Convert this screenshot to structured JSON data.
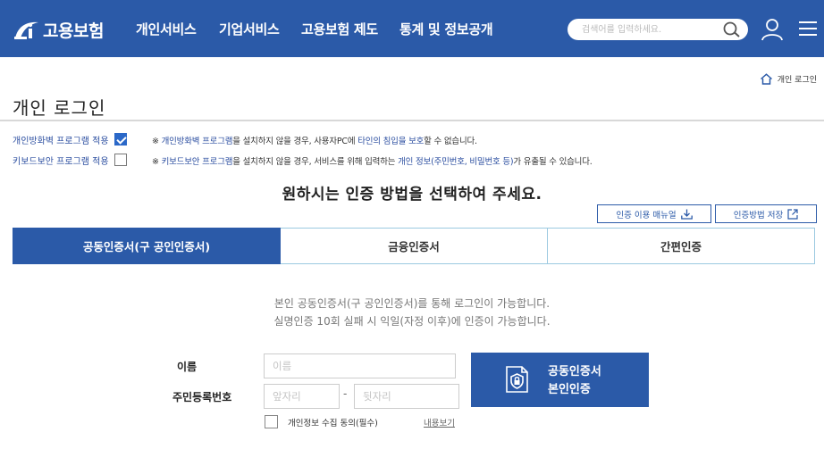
{
  "header": {
    "logo_text": "고용보험",
    "nav": [
      "개인서비스",
      "기업서비스",
      "고용보험 제도",
      "통계 및 정보공개"
    ],
    "search_placeholder": "검색어를 입력하세요.",
    "brand_color": "#2b5aa8"
  },
  "breadcrumb": {
    "home_label": "개인 로그인"
  },
  "page_title": "개인 로그인",
  "options": {
    "firewall": {
      "label": "개인방화벽 프로그램 적용",
      "checked": true,
      "note_mark": "※",
      "note_hl1": "개인방화벽 프로그램",
      "note_mid": "을 설치하지 않을 경우, 사용자PC에",
      "note_hl2": "타인의 침입을 보호",
      "note_end": "할 수 없습니다."
    },
    "keyboard": {
      "label": "키보드보안 프로그램 적용",
      "checked": false,
      "note_mark": "※",
      "note_hl1": "키보드보안 프로그램",
      "note_mid": "을 설치하지 않을 경우, 서비스를 위해 입력하는",
      "note_hl2": "개인 정보(주민번호, 비밀번호 등)",
      "note_end": "가 유출될 수 있습니다."
    }
  },
  "instruction": "원하시는 인증 방법을 선택하여 주세요.",
  "tools": {
    "manual": "인증 이용 매뉴얼",
    "save": "인증방법 저장"
  },
  "tabs": [
    {
      "label": "공동인증서(구 공인인증서)",
      "active": true
    },
    {
      "label": "금융인증서",
      "active": false
    },
    {
      "label": "간편인증",
      "active": false
    }
  ],
  "description": {
    "line1": "본인 공동인증서(구 공인인증서)를 통해 로그인이 가능합니다.",
    "line2": "실명인증 10회 실패 시 익일(자정 이후)에 인증이 가능합니다."
  },
  "form": {
    "name_label": "이름",
    "name_placeholder": "이름",
    "rrn_label": "주민등록번호",
    "rrn_front_placeholder": "앞자리",
    "rrn_separator": "-",
    "rrn_back_placeholder": "뒷자리"
  },
  "cert_button": {
    "line1": "공동인증서",
    "line2": "본인인증"
  },
  "agreement": {
    "label": "개인정보 수집 동의(필수)",
    "link": "내용보기",
    "checked": false
  }
}
